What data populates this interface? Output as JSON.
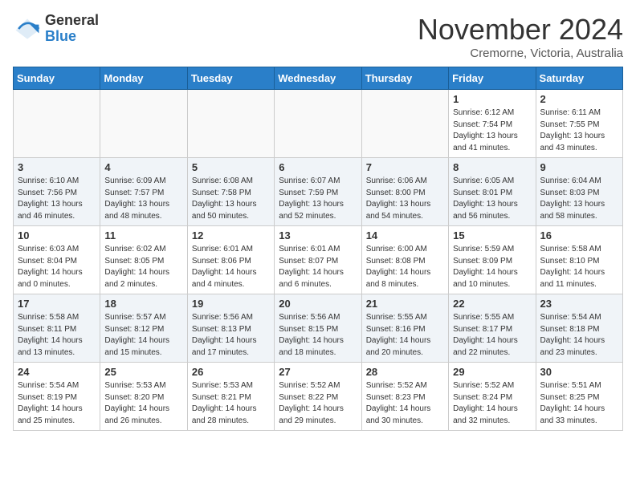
{
  "header": {
    "logo_line1": "General",
    "logo_line2": "Blue",
    "month": "November 2024",
    "location": "Cremorne, Victoria, Australia"
  },
  "weekdays": [
    "Sunday",
    "Monday",
    "Tuesday",
    "Wednesday",
    "Thursday",
    "Friday",
    "Saturday"
  ],
  "weeks": [
    [
      {
        "day": "",
        "info": ""
      },
      {
        "day": "",
        "info": ""
      },
      {
        "day": "",
        "info": ""
      },
      {
        "day": "",
        "info": ""
      },
      {
        "day": "",
        "info": ""
      },
      {
        "day": "1",
        "info": "Sunrise: 6:12 AM\nSunset: 7:54 PM\nDaylight: 13 hours\nand 41 minutes."
      },
      {
        "day": "2",
        "info": "Sunrise: 6:11 AM\nSunset: 7:55 PM\nDaylight: 13 hours\nand 43 minutes."
      }
    ],
    [
      {
        "day": "3",
        "info": "Sunrise: 6:10 AM\nSunset: 7:56 PM\nDaylight: 13 hours\nand 46 minutes."
      },
      {
        "day": "4",
        "info": "Sunrise: 6:09 AM\nSunset: 7:57 PM\nDaylight: 13 hours\nand 48 minutes."
      },
      {
        "day": "5",
        "info": "Sunrise: 6:08 AM\nSunset: 7:58 PM\nDaylight: 13 hours\nand 50 minutes."
      },
      {
        "day": "6",
        "info": "Sunrise: 6:07 AM\nSunset: 7:59 PM\nDaylight: 13 hours\nand 52 minutes."
      },
      {
        "day": "7",
        "info": "Sunrise: 6:06 AM\nSunset: 8:00 PM\nDaylight: 13 hours\nand 54 minutes."
      },
      {
        "day": "8",
        "info": "Sunrise: 6:05 AM\nSunset: 8:01 PM\nDaylight: 13 hours\nand 56 minutes."
      },
      {
        "day": "9",
        "info": "Sunrise: 6:04 AM\nSunset: 8:03 PM\nDaylight: 13 hours\nand 58 minutes."
      }
    ],
    [
      {
        "day": "10",
        "info": "Sunrise: 6:03 AM\nSunset: 8:04 PM\nDaylight: 14 hours\nand 0 minutes."
      },
      {
        "day": "11",
        "info": "Sunrise: 6:02 AM\nSunset: 8:05 PM\nDaylight: 14 hours\nand 2 minutes."
      },
      {
        "day": "12",
        "info": "Sunrise: 6:01 AM\nSunset: 8:06 PM\nDaylight: 14 hours\nand 4 minutes."
      },
      {
        "day": "13",
        "info": "Sunrise: 6:01 AM\nSunset: 8:07 PM\nDaylight: 14 hours\nand 6 minutes."
      },
      {
        "day": "14",
        "info": "Sunrise: 6:00 AM\nSunset: 8:08 PM\nDaylight: 14 hours\nand 8 minutes."
      },
      {
        "day": "15",
        "info": "Sunrise: 5:59 AM\nSunset: 8:09 PM\nDaylight: 14 hours\nand 10 minutes."
      },
      {
        "day": "16",
        "info": "Sunrise: 5:58 AM\nSunset: 8:10 PM\nDaylight: 14 hours\nand 11 minutes."
      }
    ],
    [
      {
        "day": "17",
        "info": "Sunrise: 5:58 AM\nSunset: 8:11 PM\nDaylight: 14 hours\nand 13 minutes."
      },
      {
        "day": "18",
        "info": "Sunrise: 5:57 AM\nSunset: 8:12 PM\nDaylight: 14 hours\nand 15 minutes."
      },
      {
        "day": "19",
        "info": "Sunrise: 5:56 AM\nSunset: 8:13 PM\nDaylight: 14 hours\nand 17 minutes."
      },
      {
        "day": "20",
        "info": "Sunrise: 5:56 AM\nSunset: 8:15 PM\nDaylight: 14 hours\nand 18 minutes."
      },
      {
        "day": "21",
        "info": "Sunrise: 5:55 AM\nSunset: 8:16 PM\nDaylight: 14 hours\nand 20 minutes."
      },
      {
        "day": "22",
        "info": "Sunrise: 5:55 AM\nSunset: 8:17 PM\nDaylight: 14 hours\nand 22 minutes."
      },
      {
        "day": "23",
        "info": "Sunrise: 5:54 AM\nSunset: 8:18 PM\nDaylight: 14 hours\nand 23 minutes."
      }
    ],
    [
      {
        "day": "24",
        "info": "Sunrise: 5:54 AM\nSunset: 8:19 PM\nDaylight: 14 hours\nand 25 minutes."
      },
      {
        "day": "25",
        "info": "Sunrise: 5:53 AM\nSunset: 8:20 PM\nDaylight: 14 hours\nand 26 minutes."
      },
      {
        "day": "26",
        "info": "Sunrise: 5:53 AM\nSunset: 8:21 PM\nDaylight: 14 hours\nand 28 minutes."
      },
      {
        "day": "27",
        "info": "Sunrise: 5:52 AM\nSunset: 8:22 PM\nDaylight: 14 hours\nand 29 minutes."
      },
      {
        "day": "28",
        "info": "Sunrise: 5:52 AM\nSunset: 8:23 PM\nDaylight: 14 hours\nand 30 minutes."
      },
      {
        "day": "29",
        "info": "Sunrise: 5:52 AM\nSunset: 8:24 PM\nDaylight: 14 hours\nand 32 minutes."
      },
      {
        "day": "30",
        "info": "Sunrise: 5:51 AM\nSunset: 8:25 PM\nDaylight: 14 hours\nand 33 minutes."
      }
    ]
  ]
}
